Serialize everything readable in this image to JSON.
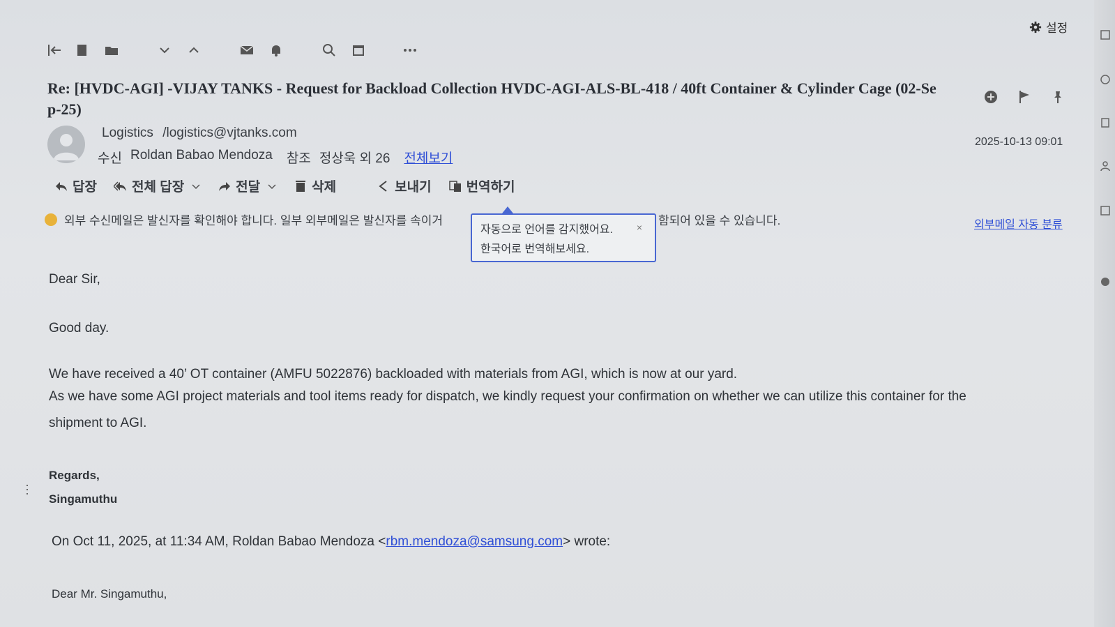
{
  "settings_label": "설정",
  "toolbar_icons": [
    "back-to-list-icon",
    "copy-icon",
    "move-folder-icon",
    "next-icon",
    "previous-icon",
    "mail-icon",
    "bell-icon",
    "zoom-icon",
    "calendar-icon",
    "more-icon"
  ],
  "subject": {
    "line1": "Re: [HVDC-AGI] -VIJAY TANKS - Request for Backload Collection HVDC-AGI-ALS-BL-418 / 40ft Container & Cylinder Cage (02-Se",
    "line2": "p-25)"
  },
  "sender": {
    "name": "Logistics",
    "email": "/logistics@vjtanks.com"
  },
  "recipients": {
    "to_label": "수신",
    "to": "Roldan Babao Mendoza",
    "cc_label": "참조",
    "cc": "정상욱 외 26",
    "view_all": "전체보기"
  },
  "date": "2025-10-13 09:01",
  "actions": {
    "reply": "답장",
    "reply_all": "전체 답장",
    "forward": "전달",
    "delete": "삭제",
    "send": "보내기",
    "translate": "번역하기"
  },
  "warning": {
    "part1": "외부 수신메일은 발신자를 확인해야 합니다. 일부 외부메일은 발신자를 속이거",
    "part2": "함되어 있을 수 있습니다.",
    "auto_classify": "외부메일 자동 분류"
  },
  "popup": {
    "line1": "자동으로 언어를 감지했어요.",
    "line2": "한국어로 번역해보세요.",
    "close": "×"
  },
  "body": {
    "greeting": "Dear Sir,",
    "good_day": "Good day.",
    "p1": "We have received a 40’ OT container (AMFU 5022876) backloaded with materials from AGI, which is now at our yard.",
    "p2a": "As we have some AGI project materials and tool items ready for dispatch, we kindly request your confirmation on whether we can utilize this container for the",
    "p2b": "shipment to AGI.",
    "regards": "Regards,",
    "signature": "Singamuthu",
    "quote_prefix": "On Oct 11, 2025, at 11:34 AM, Roldan Babao Mendoza <",
    "quote_email": "rbm.mendoza@samsung.com",
    "quote_suffix": "> wrote:",
    "quoted_greeting": "Dear Mr. Singamuthu,"
  },
  "colors": {
    "link": "#2f4fd6",
    "popup_border": "#4967d2",
    "warning_dot": "#e8b23a"
  }
}
